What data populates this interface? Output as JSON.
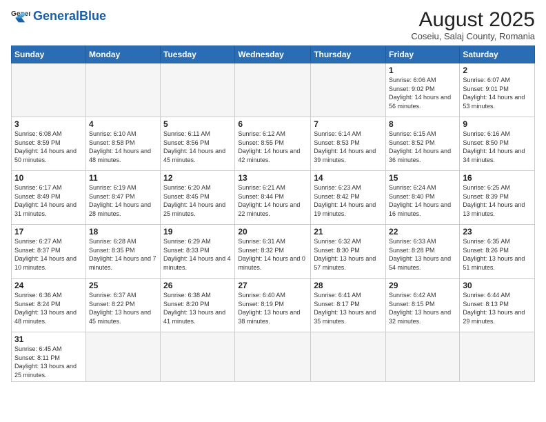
{
  "header": {
    "logo_general": "General",
    "logo_blue": "Blue",
    "month_year": "August 2025",
    "location": "Coseiu, Salaj County, Romania"
  },
  "weekdays": [
    "Sunday",
    "Monday",
    "Tuesday",
    "Wednesday",
    "Thursday",
    "Friday",
    "Saturday"
  ],
  "weeks": [
    [
      {
        "day": "",
        "info": ""
      },
      {
        "day": "",
        "info": ""
      },
      {
        "day": "",
        "info": ""
      },
      {
        "day": "",
        "info": ""
      },
      {
        "day": "",
        "info": ""
      },
      {
        "day": "1",
        "info": "Sunrise: 6:06 AM\nSunset: 9:02 PM\nDaylight: 14 hours and 56 minutes."
      },
      {
        "day": "2",
        "info": "Sunrise: 6:07 AM\nSunset: 9:01 PM\nDaylight: 14 hours and 53 minutes."
      }
    ],
    [
      {
        "day": "3",
        "info": "Sunrise: 6:08 AM\nSunset: 8:59 PM\nDaylight: 14 hours and 50 minutes."
      },
      {
        "day": "4",
        "info": "Sunrise: 6:10 AM\nSunset: 8:58 PM\nDaylight: 14 hours and 48 minutes."
      },
      {
        "day": "5",
        "info": "Sunrise: 6:11 AM\nSunset: 8:56 PM\nDaylight: 14 hours and 45 minutes."
      },
      {
        "day": "6",
        "info": "Sunrise: 6:12 AM\nSunset: 8:55 PM\nDaylight: 14 hours and 42 minutes."
      },
      {
        "day": "7",
        "info": "Sunrise: 6:14 AM\nSunset: 8:53 PM\nDaylight: 14 hours and 39 minutes."
      },
      {
        "day": "8",
        "info": "Sunrise: 6:15 AM\nSunset: 8:52 PM\nDaylight: 14 hours and 36 minutes."
      },
      {
        "day": "9",
        "info": "Sunrise: 6:16 AM\nSunset: 8:50 PM\nDaylight: 14 hours and 34 minutes."
      }
    ],
    [
      {
        "day": "10",
        "info": "Sunrise: 6:17 AM\nSunset: 8:49 PM\nDaylight: 14 hours and 31 minutes."
      },
      {
        "day": "11",
        "info": "Sunrise: 6:19 AM\nSunset: 8:47 PM\nDaylight: 14 hours and 28 minutes."
      },
      {
        "day": "12",
        "info": "Sunrise: 6:20 AM\nSunset: 8:45 PM\nDaylight: 14 hours and 25 minutes."
      },
      {
        "day": "13",
        "info": "Sunrise: 6:21 AM\nSunset: 8:44 PM\nDaylight: 14 hours and 22 minutes."
      },
      {
        "day": "14",
        "info": "Sunrise: 6:23 AM\nSunset: 8:42 PM\nDaylight: 14 hours and 19 minutes."
      },
      {
        "day": "15",
        "info": "Sunrise: 6:24 AM\nSunset: 8:40 PM\nDaylight: 14 hours and 16 minutes."
      },
      {
        "day": "16",
        "info": "Sunrise: 6:25 AM\nSunset: 8:39 PM\nDaylight: 14 hours and 13 minutes."
      }
    ],
    [
      {
        "day": "17",
        "info": "Sunrise: 6:27 AM\nSunset: 8:37 PM\nDaylight: 14 hours and 10 minutes."
      },
      {
        "day": "18",
        "info": "Sunrise: 6:28 AM\nSunset: 8:35 PM\nDaylight: 14 hours and 7 minutes."
      },
      {
        "day": "19",
        "info": "Sunrise: 6:29 AM\nSunset: 8:33 PM\nDaylight: 14 hours and 4 minutes."
      },
      {
        "day": "20",
        "info": "Sunrise: 6:31 AM\nSunset: 8:32 PM\nDaylight: 14 hours and 0 minutes."
      },
      {
        "day": "21",
        "info": "Sunrise: 6:32 AM\nSunset: 8:30 PM\nDaylight: 13 hours and 57 minutes."
      },
      {
        "day": "22",
        "info": "Sunrise: 6:33 AM\nSunset: 8:28 PM\nDaylight: 13 hours and 54 minutes."
      },
      {
        "day": "23",
        "info": "Sunrise: 6:35 AM\nSunset: 8:26 PM\nDaylight: 13 hours and 51 minutes."
      }
    ],
    [
      {
        "day": "24",
        "info": "Sunrise: 6:36 AM\nSunset: 8:24 PM\nDaylight: 13 hours and 48 minutes."
      },
      {
        "day": "25",
        "info": "Sunrise: 6:37 AM\nSunset: 8:22 PM\nDaylight: 13 hours and 45 minutes."
      },
      {
        "day": "26",
        "info": "Sunrise: 6:38 AM\nSunset: 8:20 PM\nDaylight: 13 hours and 41 minutes."
      },
      {
        "day": "27",
        "info": "Sunrise: 6:40 AM\nSunset: 8:19 PM\nDaylight: 13 hours and 38 minutes."
      },
      {
        "day": "28",
        "info": "Sunrise: 6:41 AM\nSunset: 8:17 PM\nDaylight: 13 hours and 35 minutes."
      },
      {
        "day": "29",
        "info": "Sunrise: 6:42 AM\nSunset: 8:15 PM\nDaylight: 13 hours and 32 minutes."
      },
      {
        "day": "30",
        "info": "Sunrise: 6:44 AM\nSunset: 8:13 PM\nDaylight: 13 hours and 29 minutes."
      }
    ],
    [
      {
        "day": "31",
        "info": "Sunrise: 6:45 AM\nSunset: 8:11 PM\nDaylight: 13 hours and 25 minutes."
      },
      {
        "day": "",
        "info": ""
      },
      {
        "day": "",
        "info": ""
      },
      {
        "day": "",
        "info": ""
      },
      {
        "day": "",
        "info": ""
      },
      {
        "day": "",
        "info": ""
      },
      {
        "day": "",
        "info": ""
      }
    ]
  ]
}
